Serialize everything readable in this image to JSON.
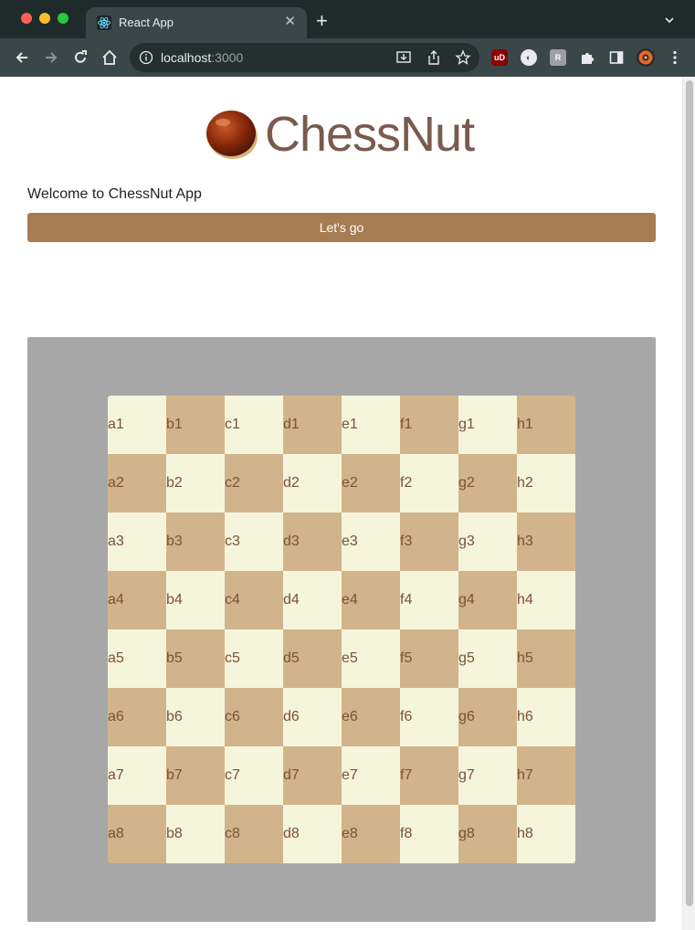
{
  "browser": {
    "tab_title": "React App",
    "tab_close": "✕",
    "new_tab": "+",
    "url_host": "localhost",
    "url_port": ":3000",
    "extensions": [
      "uBlock",
      "ext-circle",
      "ext-r",
      "puzzle",
      "sidebar",
      "profile-avatar"
    ]
  },
  "app": {
    "logo_text": "ChessNut",
    "welcome": "Welcome to ChessNut App",
    "go_button": "Let's go"
  },
  "colors": {
    "accent": "#a67c52",
    "light_square": "#f5f5dc",
    "dark_square": "#d2b48c",
    "board_background": "#a7a7a7",
    "label_color": "#7b5235"
  },
  "board": {
    "rows": [
      [
        "a1",
        "b1",
        "c1",
        "d1",
        "e1",
        "f1",
        "g1",
        "h1"
      ],
      [
        "a2",
        "b2",
        "c2",
        "d2",
        "e2",
        "f2",
        "g2",
        "h2"
      ],
      [
        "a3",
        "b3",
        "c3",
        "d3",
        "e3",
        "f3",
        "g3",
        "h3"
      ],
      [
        "a4",
        "b4",
        "c4",
        "d4",
        "e4",
        "f4",
        "g4",
        "h4"
      ],
      [
        "a5",
        "b5",
        "c5",
        "d5",
        "e5",
        "f5",
        "g5",
        "h5"
      ],
      [
        "a6",
        "b6",
        "c6",
        "d6",
        "e6",
        "f6",
        "g6",
        "h6"
      ],
      [
        "a7",
        "b7",
        "c7",
        "d7",
        "e7",
        "f7",
        "g7",
        "h7"
      ],
      [
        "a8",
        "b8",
        "c8",
        "d8",
        "e8",
        "f8",
        "g8",
        "h8"
      ]
    ]
  }
}
